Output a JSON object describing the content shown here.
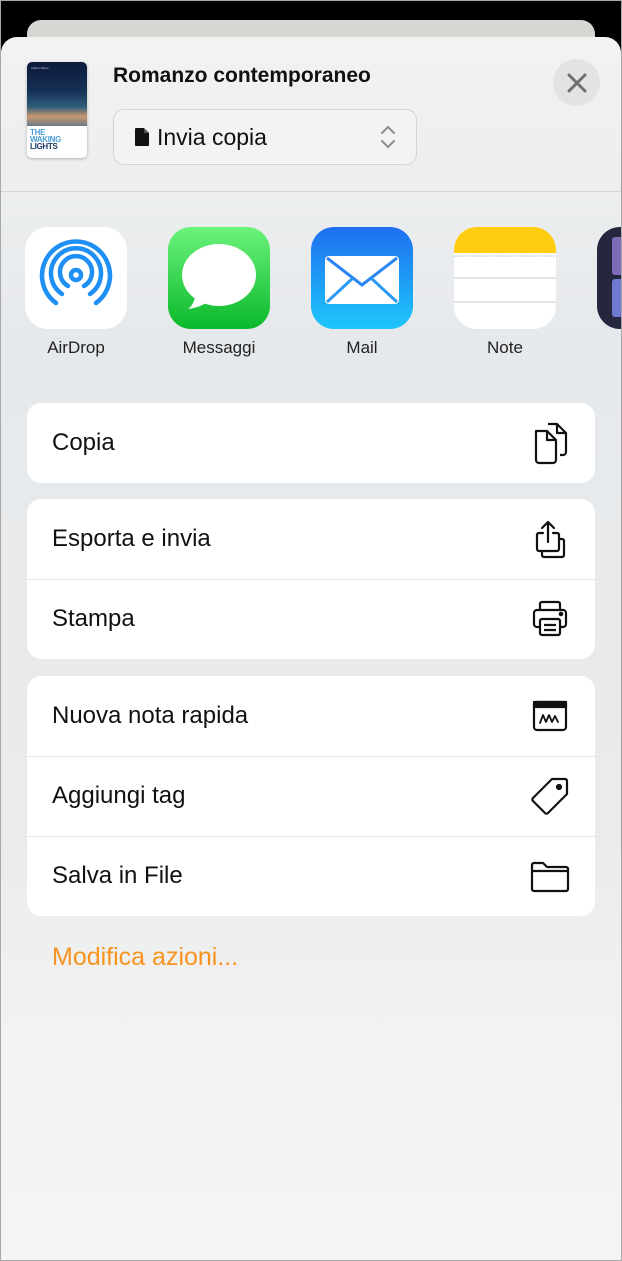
{
  "header": {
    "document_title": "Romanzo contemporaneo",
    "cover": {
      "author": "Author Name",
      "title_line1": "THE",
      "title_line2": "WAKING",
      "title_line3": "LIGHTS"
    },
    "mode_select": {
      "selected": "Invia copia",
      "icon": "document-icon"
    },
    "close_icon": "close-icon"
  },
  "apps": [
    {
      "name": "AirDrop",
      "icon": "airdrop-icon"
    },
    {
      "name": "Messaggi",
      "icon": "messages-icon"
    },
    {
      "name": "Mail",
      "icon": "mail-icon"
    },
    {
      "name": "Note",
      "icon": "notes-icon"
    },
    {
      "name": "",
      "icon": "partial-app-icon"
    }
  ],
  "action_groups": [
    [
      {
        "label": "Copia",
        "icon": "copy-icon"
      }
    ],
    [
      {
        "label": "Esporta e invia",
        "icon": "export-share-icon"
      },
      {
        "label": "Stampa",
        "icon": "printer-icon"
      }
    ],
    [
      {
        "label": "Nuova nota rapida",
        "icon": "quick-note-icon"
      },
      {
        "label": "Aggiungi tag",
        "icon": "tag-icon"
      },
      {
        "label": "Salva in File",
        "icon": "folder-icon"
      }
    ]
  ],
  "edit_actions_label": "Modifica azioni...",
  "colors": {
    "accent": "#f7931e",
    "messages_green": "#28c840",
    "mail_blue": "#1e8cf7",
    "notes_yellow": "#ffcc10",
    "airdrop_blue": "#1e8ff5"
  }
}
